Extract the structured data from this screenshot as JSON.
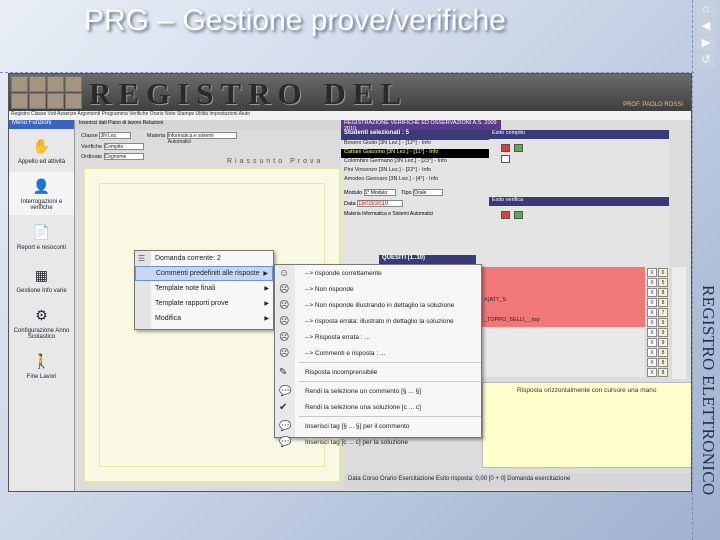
{
  "slide": {
    "title": "PRG – Gestione prove/verifiche",
    "side_text": "REGISTRO ELETTRONICO"
  },
  "app": {
    "banner_title": "REGISTRO DEL PROFESSORE",
    "banner_sub": "PROF. PAOLO ROSSI",
    "top_menu": "Registro Classe  Voti  Assenze  Argomenti  Programma  Verifiche  Orario  Note  Stampe  Utilità  Impostazioni  Aiuto",
    "nav_head": "Menu Funzioni",
    "nav_items": [
      {
        "label": "Appello ed attività",
        "icon": "hand-icon",
        "glyph": "✋"
      },
      {
        "label": "Interrogazioni e verifiche",
        "icon": "student-icon",
        "glyph": "👤"
      },
      {
        "label": "Report e resoconti",
        "icon": "report-icon",
        "glyph": "📄"
      },
      {
        "label": "Gestione Info varie",
        "icon": "grid-icon",
        "glyph": "▦"
      },
      {
        "label": "Configurazione Anno Scolastico",
        "icon": "config-icon",
        "glyph": "⚙"
      },
      {
        "label": "Fine Lavori",
        "icon": "exit-icon",
        "glyph": "🚶"
      }
    ],
    "toolbar": "Inserisci dati  Piano di lavoro  Relazioni",
    "classe_label": "Classe",
    "classe_value": "3N Lez.",
    "materia_label": "Materia",
    "materia_value": "Informatica e sistemi Automatici",
    "verifica_label": "Verifiche",
    "verifica_value": "Compito",
    "ordinate_label": "Ordinate",
    "ordinate_value": "Cognome",
    "riassunto": "Riassunto Prova",
    "reg_head": "REGISTRAZIONE VERIFICHE ED OSSERVAZIONI  A.S. 2009 2010",
    "students_head": "Studenti selezionati : 5",
    "students": [
      {
        "name": "Bovero Giulio  [3N Lez.] - [12°] - Info",
        "selected": false
      },
      {
        "name": "Cattani Giacomo  [3N Lez.] - [11°] - Info",
        "selected": true
      },
      {
        "name": "Colombini Germano  [3N Lez.] - [23°] - Info",
        "selected": false
      },
      {
        "name": "Pini Vincenzo  [3N Lez.] - [22°] - Info",
        "selected": false
      },
      {
        "name": "Amodeo Gennaro  [3N Lez.] - [4°] - Info",
        "selected": false
      }
    ],
    "modulo_label": "Modulo",
    "modulo_value": "1° Modulo",
    "tipo_label": "Tipo",
    "tipo_value": "Orale",
    "data_label": "Data",
    "data_value": "15/03/2010",
    "materia2_label": "Materia",
    "materia2_value": "Informatica e Sistemi Automatici",
    "right_head": "Esito compito",
    "right_head2": "Esito verifica",
    "quesiti_head": "QUESITI (1..10)",
    "grid_rows": [
      {
        "text": "",
        "bg": "#f07878",
        "mark": "X",
        "n": "6"
      },
      {
        "text": "",
        "bg": "#f07878",
        "mark": "X",
        "n": "5"
      },
      {
        "text": "",
        "bg": "#f07878",
        "mark": "X",
        "n": "8"
      },
      {
        "text": "X(ATT_S",
        "bg": "#f07878",
        "mark": "X",
        "n": "8"
      },
      {
        "text": ":",
        "bg": "#f07878",
        "mark": "X",
        "n": "7"
      },
      {
        "text": "_TOPPO_SELLI_ _top",
        "bg": "#f07878",
        "mark": "X",
        "n": "9"
      },
      {
        "text": "",
        "bg": "#e8e8e8",
        "mark": "X",
        "n": "9"
      },
      {
        "text": "",
        "bg": "#e8e8e8",
        "mark": "X",
        "n": "9"
      },
      {
        "text": "",
        "bg": "#e8e8e8",
        "mark": "X",
        "n": "8"
      },
      {
        "text": "",
        "bg": "#e8e8e8",
        "mark": "X",
        "n": "8"
      },
      {
        "text": "",
        "bg": "#e8e8e8",
        "mark": "X",
        "n": "8"
      }
    ],
    "yellow_text": "Risposta orizzontalmente con cursore una mano",
    "bottom_bar": "Data Corso  Orario Esercitazione  Esito risposta: 0,00 [0 + 0]   Domanda esercitazione"
  },
  "context_menu": {
    "header": "Domanda corrente: 2",
    "items": [
      {
        "label": "Commenti predefiniti alle risposte",
        "active": true,
        "submenu": true
      },
      {
        "label": "Template note finali",
        "active": false,
        "submenu": true
      },
      {
        "label": "Template rapporti prove",
        "active": false,
        "submenu": true
      },
      {
        "label": "Modifica",
        "active": false,
        "submenu": true
      }
    ]
  },
  "submenu": {
    "items": [
      {
        "label": "--> risponde correttamente",
        "icon": "smile-icon",
        "glyph": "☺"
      },
      {
        "label": "--> Non risponde",
        "icon": "neutral-icon",
        "glyph": "☹"
      },
      {
        "label": "--> Non risponde illustrando in dettaglio la soluzione",
        "icon": "neutral-icon",
        "glyph": "☹"
      },
      {
        "label": "--> risposta errata: illustrato in dettaglio la soluzione",
        "icon": "neutral-icon",
        "glyph": "☹"
      },
      {
        "label": "--> Risposta errata : ...",
        "icon": "frown-icon",
        "glyph": "☹"
      },
      {
        "label": "--> Commenti e risposta : ...",
        "icon": "frown-icon",
        "glyph": "☹"
      },
      {
        "label": "Risposta incomprensibile",
        "icon": "edit-icon",
        "glyph": "✎"
      },
      {
        "label": "Rendi la selezione un commento [§ ... §]",
        "icon": "comment-icon",
        "glyph": "💬"
      },
      {
        "label": "Rendi la selezione una soluzione [c ... c]",
        "icon": "solution-icon",
        "glyph": "✔"
      },
      {
        "label": "Inserisci tag [§ ... §] per il commento",
        "icon": "tag-icon",
        "glyph": "💬"
      },
      {
        "label": "Inserisci tag [c ... c] per la soluzione",
        "icon": "tag-icon",
        "glyph": "💬"
      }
    ]
  }
}
